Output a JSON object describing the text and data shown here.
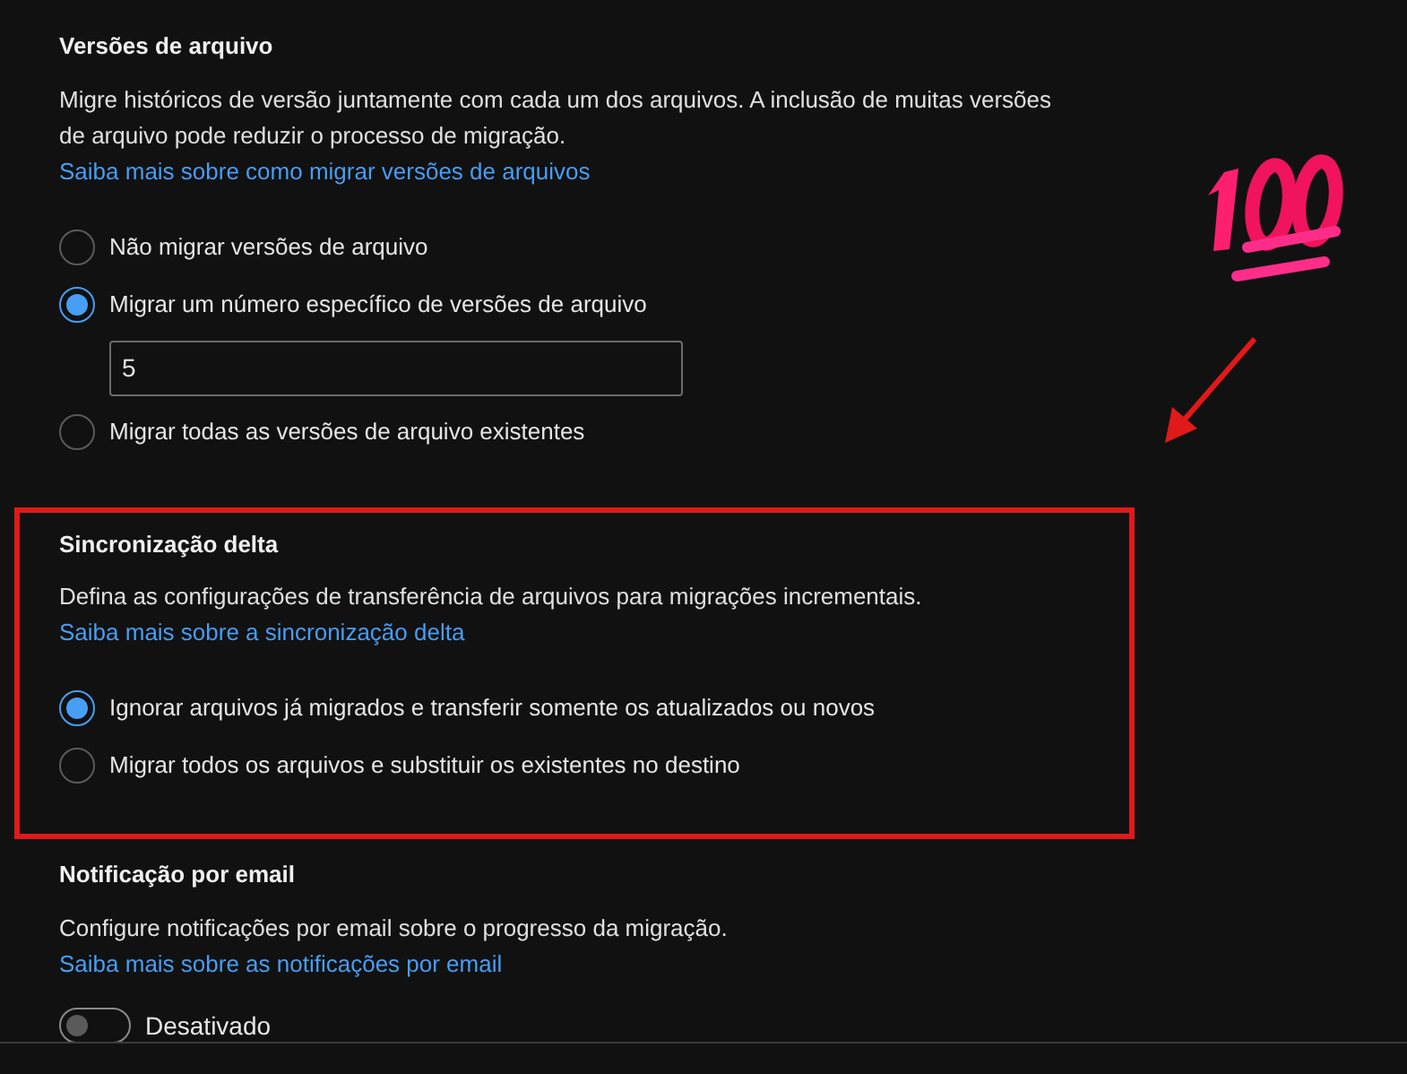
{
  "sections": [
    {
      "title": "Versões de arquivo",
      "description": "Migre históricos de versão juntamente com cada um dos arquivos. A inclusão de muitas versões de arquivo pode reduzir o processo de migração.",
      "link": "Saiba mais sobre como migrar versões de arquivos",
      "highlighted": false,
      "options": [
        {
          "label": "Não migrar versões de arquivo",
          "selected": false
        },
        {
          "label": "Migrar um número específico de versões de arquivo",
          "selected": true,
          "field_value": "5"
        },
        {
          "label": "Migrar todas as versões de arquivo existentes",
          "selected": false
        }
      ]
    },
    {
      "title": "Sincronização delta",
      "description": "Defina as configurações de transferência de arquivos para migrações incrementais.",
      "link": "Saiba mais sobre a sincronização delta",
      "highlighted": true,
      "options": [
        {
          "label": "Ignorar arquivos já migrados e transferir somente os atualizados ou novos",
          "selected": true
        },
        {
          "label": "Migrar todos os arquivos e substituir os existentes no destino",
          "selected": false
        }
      ]
    },
    {
      "title": "Notificação por email",
      "description": "Configure notificações por email sobre o progresso da migração.",
      "link": "Saiba mais sobre as notificações por email",
      "highlighted": false,
      "toggle": {
        "on": false,
        "label": "Desativado"
      }
    }
  ]
}
